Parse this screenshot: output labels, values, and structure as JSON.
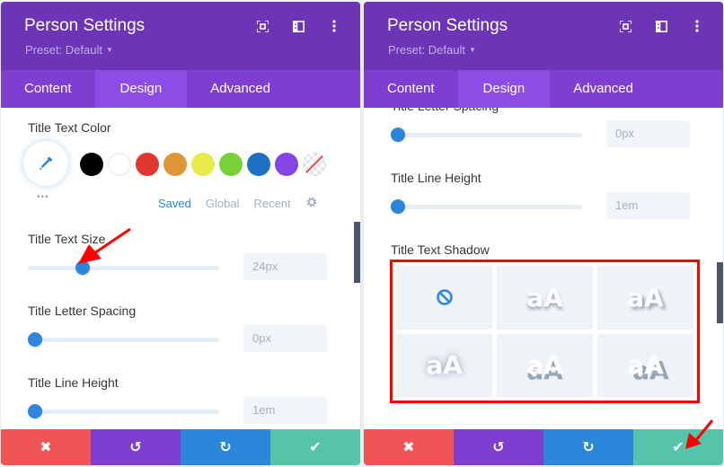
{
  "left_panel": {
    "title": "Person Settings",
    "preset": "Preset: Default",
    "tabs": [
      {
        "label": "Content"
      },
      {
        "label": "Design",
        "active": true
      },
      {
        "label": "Advanced"
      }
    ],
    "title_text_color": {
      "label": "Title Text Color",
      "swatches": [
        "#000000",
        "#ffffff",
        "#e02b20",
        "#e09900",
        "#edf000",
        "#7cda24",
        "#0c71c3",
        "#8300e9"
      ],
      "palette_tabs": [
        "Saved",
        "Global",
        "Recent"
      ],
      "more_dots": "•••"
    },
    "title_text_size": {
      "label": "Title Text Size",
      "value": "24px",
      "slider_fraction": 0.25
    },
    "title_letter_spacing": {
      "label": "Title Letter Spacing",
      "value": "0px",
      "slider_fraction": 0
    },
    "title_line_height": {
      "label": "Title Line Height",
      "value": "1em",
      "slider_fraction": 0
    }
  },
  "right_panel": {
    "title": "Person Settings",
    "preset": "Preset: Default",
    "tabs": [
      {
        "label": "Content"
      },
      {
        "label": "Design",
        "active": true
      },
      {
        "label": "Advanced"
      }
    ],
    "title_letter_spacing": {
      "label": "Title Letter Spacing",
      "value": "0px",
      "slider_fraction": 0
    },
    "title_line_height": {
      "label": "Title Line Height",
      "value": "1em",
      "slider_fraction": 0
    },
    "title_text_shadow": {
      "label": "Title Text Shadow",
      "sample_text": "aA",
      "options": [
        "none",
        "bottom",
        "bottom-right",
        "glow",
        "bottom-solid",
        "bottom-right-solid"
      ]
    }
  },
  "footer": {
    "buttons": [
      {
        "name": "cancel",
        "icon": "✖",
        "color": "#ef5555"
      },
      {
        "name": "undo",
        "icon": "↺",
        "color": "#7e3fd0"
      },
      {
        "name": "redo",
        "icon": "↻",
        "color": "#2b87da"
      },
      {
        "name": "save",
        "icon": "✔",
        "color": "#56c4aa"
      }
    ]
  },
  "annotation_color": "#ff0000"
}
